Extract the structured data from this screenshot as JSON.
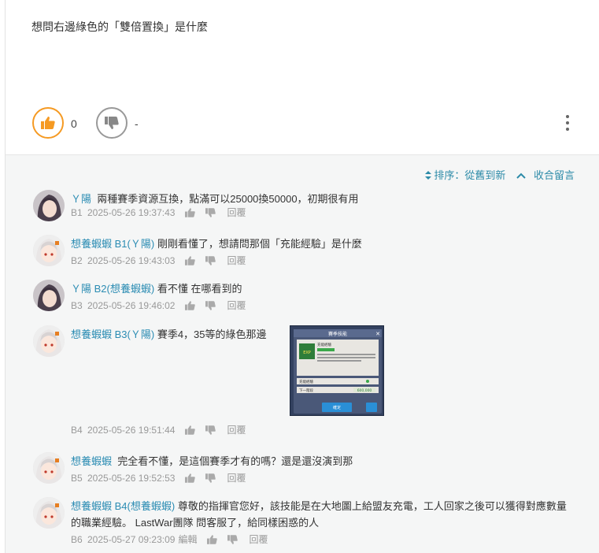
{
  "post": {
    "text": "想問右邊綠色的「雙倍置換」是什麼",
    "like_count": "0",
    "dislike_label": "-"
  },
  "toolbar": {
    "sort_label": "排序：從舊到新",
    "collapse_label": "收合留言"
  },
  "comments": [
    {
      "user": "Ｙ陽",
      "reply_to": "",
      "text": "兩種賽季資源互換，點滿可以25000換50000，初期很有用",
      "floor": "B1",
      "time": "2025-05-26 19:37:43",
      "edited": "",
      "reply_label": "回覆",
      "avatar": "dark-hair"
    },
    {
      "user": "想養蝦蝦",
      "reply_to": "B1(Ｙ陽)",
      "text": "剛剛看懂了，想請問那個「充能經驗」是什麼",
      "floor": "B2",
      "time": "2025-05-26 19:43:03",
      "edited": "",
      "reply_label": "回覆",
      "avatar": "white-hair"
    },
    {
      "user": "Ｙ陽",
      "reply_to": "B2(想養蝦蝦)",
      "text": "看不懂 在哪看到的",
      "floor": "B3",
      "time": "2025-05-26 19:46:02",
      "edited": "",
      "reply_label": "回覆",
      "avatar": "dark-hair"
    },
    {
      "user": "想養蝦蝦",
      "reply_to": "B3(Ｙ陽)",
      "text": "賽季4，35等的綠色那邊",
      "floor": "B4",
      "time": "2025-05-26 19:51:44",
      "edited": "",
      "reply_label": "回覆",
      "avatar": "white-hair"
    },
    {
      "user": "想養蝦蝦",
      "reply_to": "",
      "text": "完全看不懂，是這個賽季才有的嗎？還是還沒演到那",
      "floor": "B5",
      "time": "2025-05-26 19:52:53",
      "edited": "",
      "reply_label": "回覆",
      "avatar": "white-hair"
    },
    {
      "user": "想養蝦蝦",
      "reply_to": "B4(想養蝦蝦)",
      "text": "尊敬的指揮官您好，該技能是在大地圖上給盟友充電，工人回家之後可以獲得對應數量的職業經驗。 LastWar團隊 問客服了，給同樣困惑的人",
      "floor": "B6",
      "time": "2025-05-27 09:23:09",
      "edited": "編輯",
      "reply_label": "回覆",
      "avatar": "white-hair"
    }
  ],
  "attachment": {
    "title": "賽季技能",
    "card_title": "充能經驗",
    "badge": "EXP",
    "row1": "充能經驗",
    "row2_left": "下一階段",
    "row2_right": "600,000",
    "button": "確定"
  },
  "colors": {
    "accent_orange": "#f59a23",
    "link_blue": "#2b8cb3",
    "panel_bg": "#f5f6f6"
  }
}
